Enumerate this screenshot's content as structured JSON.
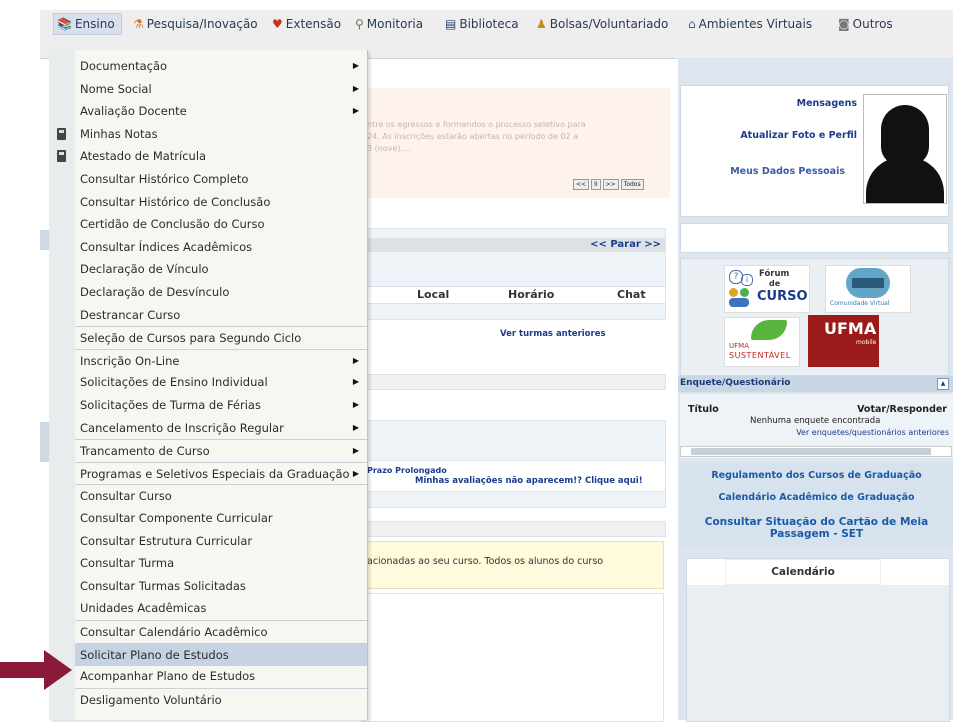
{
  "menubar": {
    "items": [
      {
        "label": "Ensino",
        "icon": "book-icon",
        "glyph": "📚"
      },
      {
        "label": "Pesquisa/Inovação",
        "icon": "flask-icon",
        "glyph": "⚗"
      },
      {
        "label": "Extensão",
        "icon": "heart-icon",
        "glyph": "♥"
      },
      {
        "label": "Monitoria",
        "icon": "monitor-icon",
        "glyph": "⚲"
      },
      {
        "label": "Biblioteca",
        "icon": "library-icon",
        "glyph": "▤"
      },
      {
        "label": "Bolsas/Voluntariado",
        "icon": "people-icon",
        "glyph": "♟"
      },
      {
        "label": "Ambientes Virtuais",
        "icon": "globe-icon",
        "glyph": "⌂"
      },
      {
        "label": "Outros",
        "icon": "box-icon",
        "glyph": "◙"
      }
    ]
  },
  "dropdown": {
    "items": [
      {
        "label": "Documentação",
        "submenu": true
      },
      {
        "label": "Nome Social",
        "submenu": true
      },
      {
        "label": "Avaliação Docente",
        "submenu": true
      },
      {
        "label": "Minhas Notas",
        "icon": "document-icon"
      },
      {
        "label": "Atestado de Matrícula",
        "icon": "document-icon"
      },
      {
        "label": "Consultar Histórico Completo"
      },
      {
        "label": "Consultar Histórico de Conclusão"
      },
      {
        "label": "Certidão de Conclusão do Curso"
      },
      {
        "label": "Consultar Índices Acadêmicos"
      },
      {
        "label": "Declaração de Vínculo"
      },
      {
        "label": "Declaração de Desvínculo"
      },
      {
        "label": "Destrancar Curso"
      },
      {
        "label": "Seleção de Cursos para Segundo Ciclo",
        "sep": true
      },
      {
        "label": "Inscrição On-Line",
        "submenu": true,
        "sep": true
      },
      {
        "label": "Solicitações de Ensino Individual",
        "submenu": true
      },
      {
        "label": "Solicitações de Turma de Férias",
        "submenu": true
      },
      {
        "label": "Cancelamento de Inscrição Regular",
        "submenu": true
      },
      {
        "label": "Trancamento de Curso",
        "submenu": true,
        "sep": true
      },
      {
        "label": "Programas e Seletivos Especiais da Graduação",
        "submenu": true,
        "sep": true
      },
      {
        "label": "Consultar Curso",
        "sep": true
      },
      {
        "label": "Consultar Componente Curricular"
      },
      {
        "label": "Consultar Estrutura Curricular"
      },
      {
        "label": "Consultar Turma"
      },
      {
        "label": "Consultar Turmas Solicitadas"
      },
      {
        "label": "Unidades Acadêmicas"
      },
      {
        "label": "Consultar Calendário Acadêmico",
        "sep": true
      },
      {
        "label": "Solicitar Plano de Estudos",
        "sep": true,
        "highlight": true
      },
      {
        "label": "Acompanhar Plano de Estudos"
      },
      {
        "label": "Desligamento Voluntário",
        "sep": true
      }
    ]
  },
  "background": {
    "notice_line1": "ntre os egressos e formandos o processo seletivo para",
    "notice_line2": "24. As inscrições estarão abertas no período de 02 a",
    "notice_line3": "3 (nove)....",
    "pager": [
      "<<",
      "II",
      ">>",
      "Todos"
    ],
    "parar": "<< Parar >>",
    "col_local": "Local",
    "col_horario": "Horário",
    "col_chat": "Chat",
    "ver_turmas": "Ver turmas anteriores",
    "prazo": "Prazo Prolongado",
    "avaliacoes": "Minhas avaliações não aparecem!? Clique aqui!",
    "cursos_notice": "acionadas ao seu curso. Todos os alunos do curso"
  },
  "right": {
    "mensagens": "Mensagens",
    "atualizar": "Atualizar Foto e Perfil",
    "meus_dados": "Meus Dados Pessoais",
    "forum": {
      "line1": "Fórum",
      "line2": "de",
      "line3": "CURSO"
    },
    "comunidade": "Comunidade Virtual",
    "ufma_sustentavel": {
      "line1": "UFMA",
      "line2": "SUSTENTÁVEL"
    },
    "ufma_mobile": {
      "line1": "UFMA",
      "line2": "mobile"
    },
    "enquete_title": "Enquete/Questionário",
    "enquete_col_titulo": "Título",
    "enquete_col_votar": "Votar/Responder",
    "enquete_none": "Nenhuma enquete encontrada",
    "enquete_anteriores": "Ver enquetes/questionários anteriores",
    "regulamento": "Regulamento dos Cursos de Graduação",
    "calendario_link": "Calendário Acadêmico de Graduação",
    "situacao": "Consultar Situação do Cartão de Meia Passagem - SET",
    "calendario_box": "Calendário"
  },
  "colors": {
    "accent": "#1a3c8c",
    "arrow": "#8b1a3a",
    "highlight": "#c7d2e2"
  }
}
